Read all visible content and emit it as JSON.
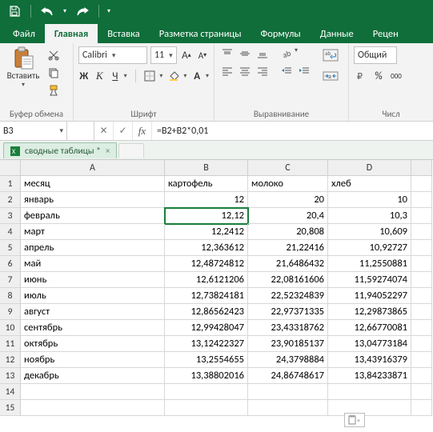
{
  "titlebar": {
    "save": "save",
    "undo": "undo",
    "redo": "redo",
    "customize": "customize"
  },
  "tabs": {
    "file": "Файл",
    "home": "Главная",
    "insert": "Вставка",
    "pagelayout": "Разметка страницы",
    "formulas": "Формулы",
    "data": "Данные",
    "review": "Рецен"
  },
  "ribbon": {
    "clipboard": {
      "paste": "Вставить",
      "label": "Буфер обмена"
    },
    "font": {
      "name": "Calibri",
      "size": "11",
      "bold": "Ж",
      "italic": "К",
      "underline": "Ч",
      "label": "Шрифт"
    },
    "alignment": {
      "label": "Выравнивание"
    },
    "number": {
      "format": "Общий",
      "label": "Числ"
    }
  },
  "namebox": "B3",
  "formula": "=B2+B2*0,01",
  "workbook": {
    "name": "сводные таблицы *"
  },
  "columns": [
    "A",
    "B",
    "C",
    "D"
  ],
  "rows": [
    {
      "n": "1",
      "A": "месяц",
      "B": "картофель",
      "C": "молоко",
      "D": "хлеб"
    },
    {
      "n": "2",
      "A": "январь",
      "B": "12",
      "C": "20",
      "D": "10"
    },
    {
      "n": "3",
      "A": "февраль",
      "B": "12,12",
      "C": "20,4",
      "D": "10,3"
    },
    {
      "n": "4",
      "A": "март",
      "B": "12,2412",
      "C": "20,808",
      "D": "10,609"
    },
    {
      "n": "5",
      "A": "апрель",
      "B": "12,363612",
      "C": "21,22416",
      "D": "10,92727"
    },
    {
      "n": "6",
      "A": "май",
      "B": "12,48724812",
      "C": "21,6486432",
      "D": "11,2550881"
    },
    {
      "n": "7",
      "A": "июнь",
      "B": "12,6121206",
      "C": "22,08161606",
      "D": "11,59274074"
    },
    {
      "n": "8",
      "A": "июль",
      "B": "12,73824181",
      "C": "22,52324839",
      "D": "11,94052297"
    },
    {
      "n": "9",
      "A": "август",
      "B": "12,86562423",
      "C": "22,97371335",
      "D": "12,29873865"
    },
    {
      "n": "10",
      "A": "сентябрь",
      "B": "12,99428047",
      "C": "23,43318762",
      "D": "12,66770081"
    },
    {
      "n": "11",
      "A": "октябрь",
      "B": "13,12422327",
      "C": "23,90185137",
      "D": "13,04773184"
    },
    {
      "n": "12",
      "A": "ноябрь",
      "B": "13,2554655",
      "C": "24,3798884",
      "D": "13,43916379"
    },
    {
      "n": "13",
      "A": "декабрь",
      "B": "13,38802016",
      "C": "24,86748617",
      "D": "13,84233871"
    },
    {
      "n": "14",
      "A": "",
      "B": "",
      "C": "",
      "D": ""
    },
    {
      "n": "15",
      "A": "",
      "B": "",
      "C": "",
      "D": ""
    }
  ],
  "active_cell": {
    "row_index": 2,
    "col": "B"
  },
  "chart_data": {
    "type": "table",
    "title": "",
    "columns": [
      "месяц",
      "картофель",
      "молоко",
      "хлеб"
    ],
    "records": [
      {
        "месяц": "январь",
        "картофель": 12,
        "молоко": 20,
        "хлеб": 10
      },
      {
        "месяц": "февраль",
        "картофель": 12.12,
        "молоко": 20.4,
        "хлеб": 10.3
      },
      {
        "месяц": "март",
        "картофель": 12.2412,
        "молоко": 20.808,
        "хлеб": 10.609
      },
      {
        "месяц": "апрель",
        "картофель": 12.363612,
        "молоко": 21.22416,
        "хлеб": 10.92727
      },
      {
        "месяц": "май",
        "картофель": 12.48724812,
        "молоко": 21.6486432,
        "хлеб": 11.2550881
      },
      {
        "месяц": "июнь",
        "картофель": 12.6121206,
        "молоко": 22.08161606,
        "хлеб": 11.59274074
      },
      {
        "месяц": "июль",
        "картофель": 12.73824181,
        "молоко": 22.52324839,
        "хлеб": 11.94052297
      },
      {
        "месяц": "август",
        "картофель": 12.86562423,
        "молоко": 22.97371335,
        "хлеб": 12.29873865
      },
      {
        "месяц": "сентябрь",
        "картофель": 12.99428047,
        "молоко": 23.43318762,
        "хлеб": 12.66770081
      },
      {
        "месяц": "октябрь",
        "картофель": 13.12422327,
        "молоко": 23.90185137,
        "хлеб": 13.04773184
      },
      {
        "месяц": "ноябрь",
        "картофель": 13.2554655,
        "молоко": 24.3798884,
        "хлеб": 13.43916379
      },
      {
        "месяц": "декабрь",
        "картофель": 13.38802016,
        "молоко": 24.86748617,
        "хлеб": 13.84233871
      }
    ]
  }
}
